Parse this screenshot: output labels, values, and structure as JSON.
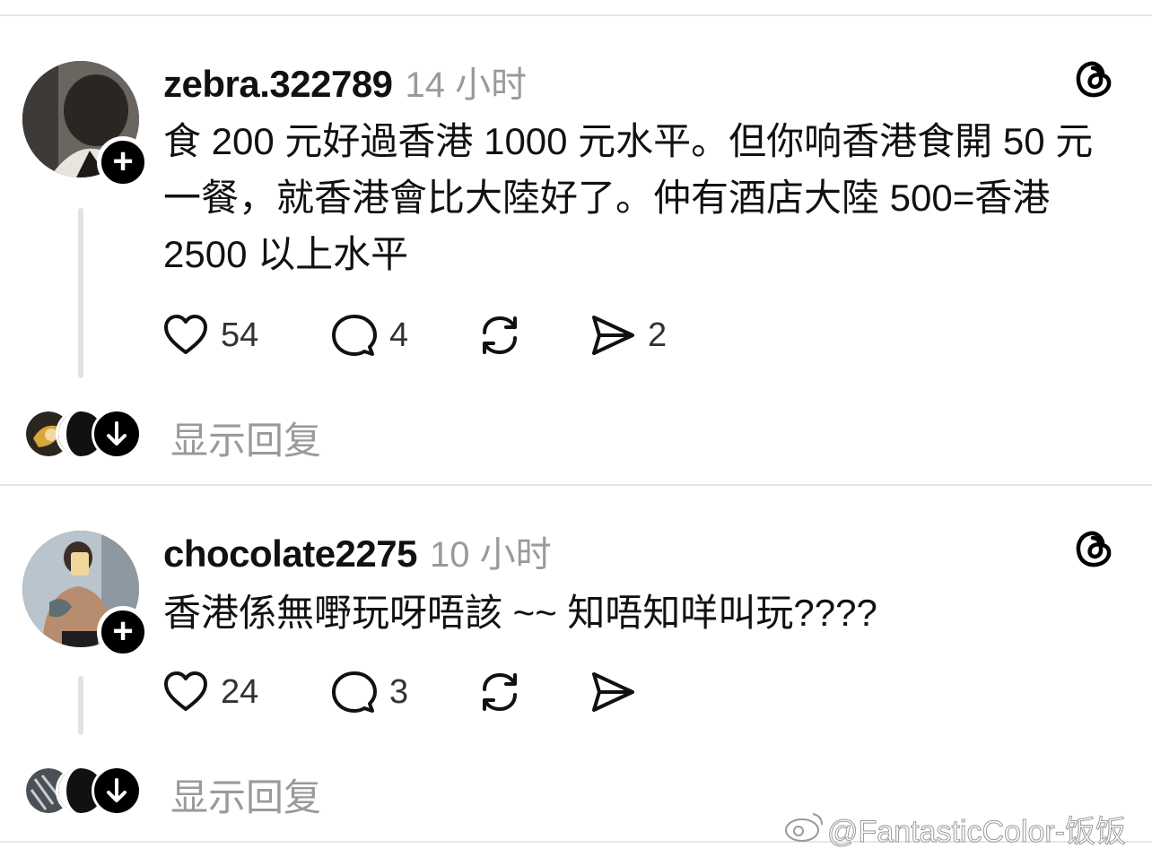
{
  "posts": [
    {
      "username": "zebra.322789",
      "time": "14 小时",
      "content": "食 200 元好過香港 1000 元水平。但你响香港食開 50 元一餐，就香港會比大陸好了。仲有酒店大陸 500=香港 2500 以上水平",
      "likes": "54",
      "comments": "4",
      "shares": "2",
      "show_replies": "显示回复"
    },
    {
      "username": "chocolate2275",
      "time": "10 小时",
      "content": "香港係無嘢玩呀唔該 ~~ 知唔知咩叫玩????",
      "likes": "24",
      "comments": "3",
      "shares": "",
      "show_replies": "显示回复"
    }
  ],
  "icons": {
    "follow": "plus-icon",
    "like": "heart-icon",
    "comment": "comment-bubble-icon",
    "repost": "repost-icon",
    "share": "send-icon",
    "app": "threads-logo-icon",
    "show_more": "arrow-down-icon"
  },
  "watermark": "@FantasticColor-饭饭",
  "colors": {
    "text": "#111111",
    "muted": "#9a9a9a",
    "divider": "#e6e6e6"
  }
}
